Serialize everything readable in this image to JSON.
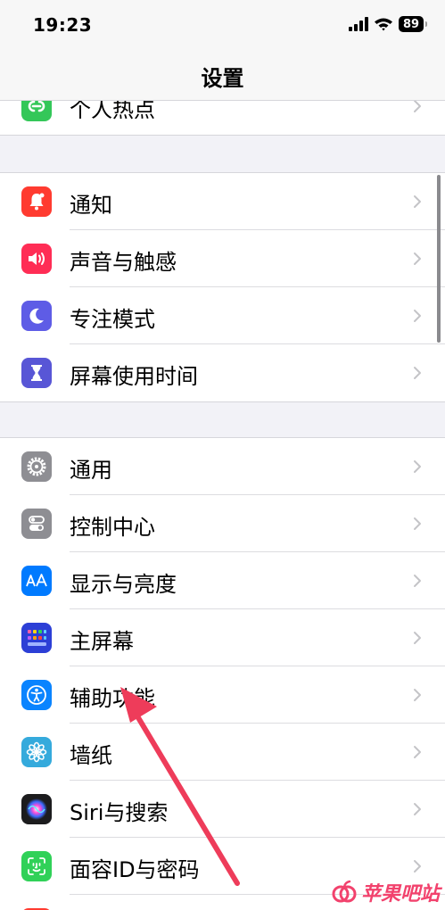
{
  "status_bar": {
    "time": "19:23",
    "battery": "89"
  },
  "nav": {
    "title": "设置"
  },
  "groups": [
    {
      "items": [
        {
          "label": "个人热点",
          "icon": "hotspot-icon",
          "color": "#34c759"
        }
      ]
    },
    {
      "items": [
        {
          "label": "通知",
          "icon": "notification-bell-icon",
          "color": "#ff3b30"
        },
        {
          "label": "声音与触感",
          "icon": "speaker-icon",
          "color": "#ff2d55"
        },
        {
          "label": "专注模式",
          "icon": "moon-icon",
          "color": "#5e5ce6"
        },
        {
          "label": "屏幕使用时间",
          "icon": "hourglass-icon",
          "color": "#5856d6"
        }
      ]
    },
    {
      "items": [
        {
          "label": "通用",
          "icon": "gear-icon",
          "color": "#8e8e93"
        },
        {
          "label": "控制中心",
          "icon": "toggles-icon",
          "color": "#8e8e93"
        },
        {
          "label": "显示与亮度",
          "icon": "text-size-icon",
          "color": "#007aff"
        },
        {
          "label": "主屏幕",
          "icon": "app-grid-icon",
          "color": "#2c3fd6"
        },
        {
          "label": "辅助功能",
          "icon": "accessibility-icon",
          "color": "#0a84ff"
        },
        {
          "label": "墙纸",
          "icon": "flower-icon",
          "color": "#35aadc"
        },
        {
          "label": "Siri与搜索",
          "icon": "siri-icon",
          "color": "#1c1c1e"
        },
        {
          "label": "面容ID与密码",
          "icon": "face-id-icon",
          "color": "#30d158"
        },
        {
          "label": "",
          "icon": "sos-icon",
          "color": "#ff3b30"
        }
      ]
    }
  ],
  "annotation": {
    "arrow_color": "#ee3c5a",
    "target": "辅助功能"
  },
  "watermark": {
    "text": "苹果吧站"
  }
}
